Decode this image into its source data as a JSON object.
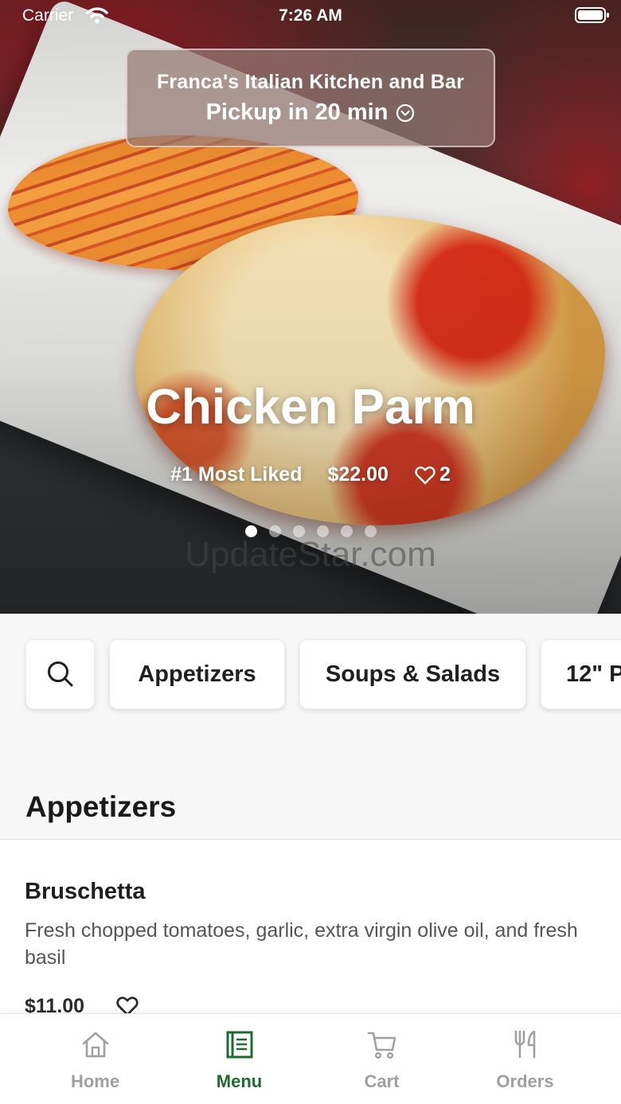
{
  "status_bar": {
    "carrier": "Carrier",
    "time": "7:26 AM"
  },
  "store": {
    "name": "Franca's Italian Kitchen and Bar",
    "pickup": "Pickup in 20 min"
  },
  "featured": {
    "title": "Chicken Parm",
    "rank": "#1 Most Liked",
    "price": "$22.00",
    "likes": "2",
    "slide_count": 6,
    "active_slide": 1
  },
  "watermark": "UpdateStar.com",
  "categories": [
    "Appetizers",
    "Soups & Salads",
    "12\" P"
  ],
  "section": {
    "title": "Appetizers"
  },
  "item": {
    "name": "Bruschetta",
    "description": "Fresh chopped tomatoes, garlic, extra virgin olive oil, and fresh basil",
    "price": "$11.00"
  },
  "tabs": [
    {
      "label": "Home",
      "icon": "home-icon",
      "active": false
    },
    {
      "label": "Menu",
      "icon": "menu-book-icon",
      "active": true
    },
    {
      "label": "Cart",
      "icon": "cart-icon",
      "active": false
    },
    {
      "label": "Orders",
      "icon": "utensils-icon",
      "active": false
    }
  ],
  "colors": {
    "accent": "#1e6b2e",
    "inactive": "#a0a0a0",
    "background": "#f7f7f7"
  }
}
